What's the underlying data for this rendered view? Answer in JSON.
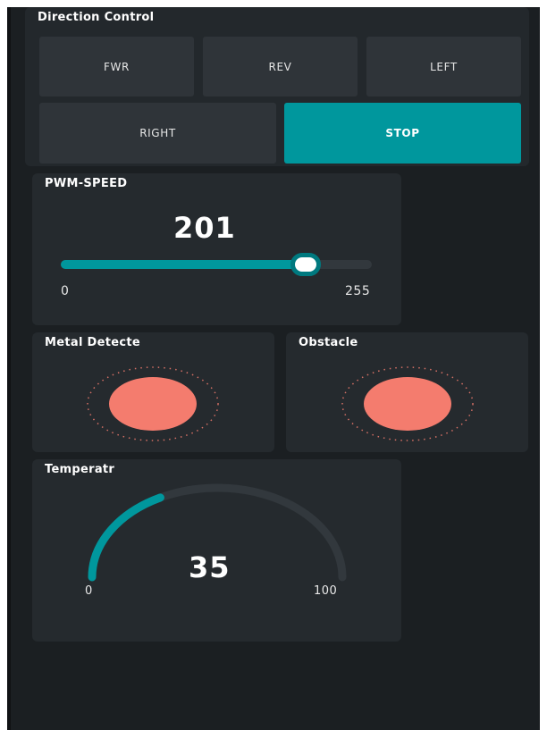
{
  "direction": {
    "title": "Direction Control",
    "buttons": [
      {
        "label": "FWR",
        "active": false
      },
      {
        "label": "REV",
        "active": false
      },
      {
        "label": "LEFT",
        "active": false
      },
      {
        "label": "RIGHT",
        "active": false
      },
      {
        "label": "STOP",
        "active": true
      }
    ]
  },
  "pwm": {
    "title": "PWM-SPEED",
    "value": "201",
    "min": "0",
    "max": "255",
    "fraction": 0.788
  },
  "metal": {
    "title": "Metal Detecte",
    "led_color": "#f47c6e",
    "led_icon": "led-indicator-icon"
  },
  "obstacle": {
    "title": "Obstacle",
    "led_color": "#f47c6e",
    "led_icon": "led-indicator-icon"
  },
  "temperature": {
    "title": "Temperatr",
    "value": "35",
    "min": "0",
    "max": "100",
    "fraction": 0.35
  },
  "colors": {
    "accent": "#00979d",
    "led": "#f47c6e",
    "background": "#1b1f22",
    "card": "#252a2e",
    "button": "#2f3439"
  }
}
